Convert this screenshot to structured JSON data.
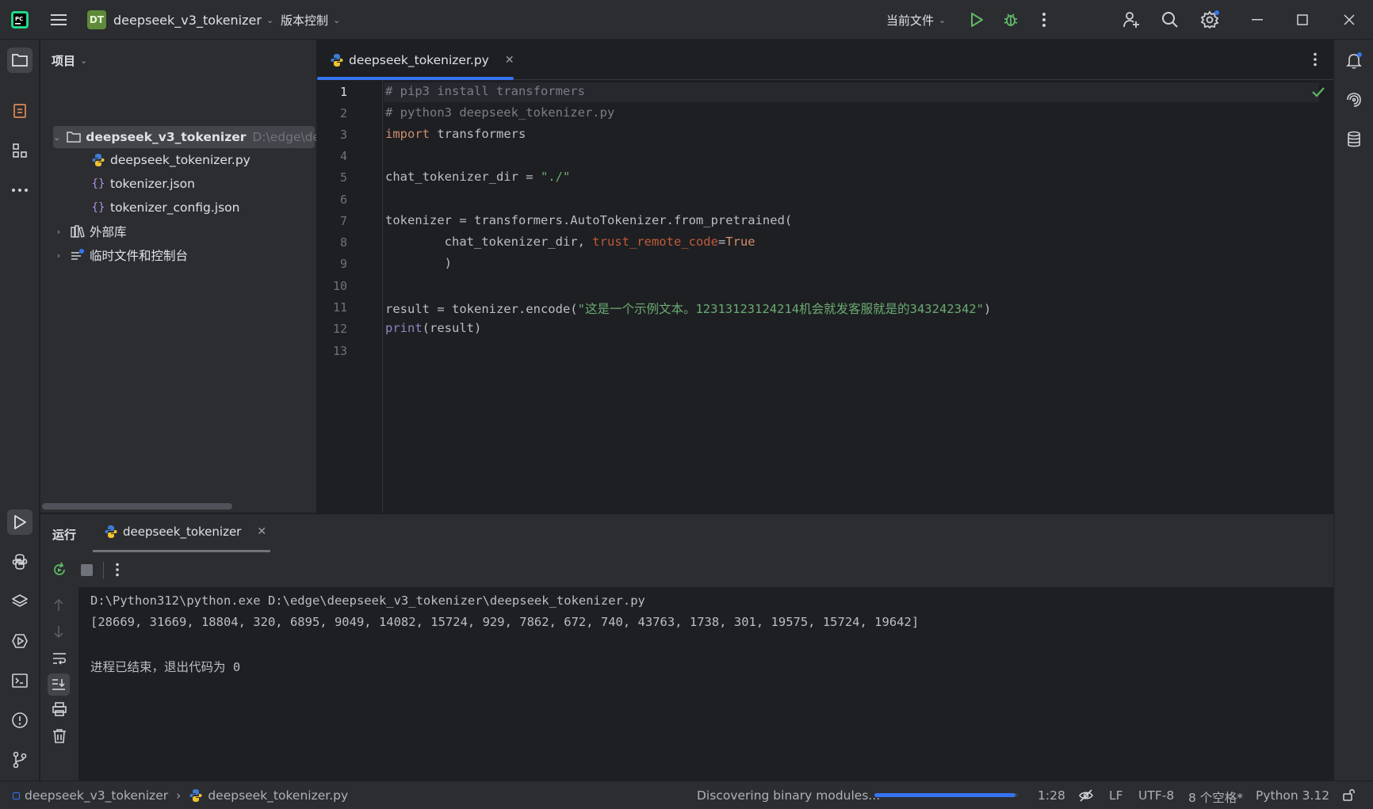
{
  "titlebar": {
    "project_badge": "DT",
    "project_name": "deepseek_v3_tokenizer",
    "vcs_menu": "版本控制",
    "run_config": "当前文件"
  },
  "project_panel": {
    "title": "项目",
    "root": {
      "name": "deepseek_v3_tokenizer",
      "path": "D:\\edge\\deep"
    },
    "files": [
      {
        "name": "deepseek_tokenizer.py",
        "icon": "python-file-icon"
      },
      {
        "name": "tokenizer.json",
        "icon": "json-file-icon"
      },
      {
        "name": "tokenizer_config.json",
        "icon": "json-file-icon"
      }
    ],
    "external_libs": "外部库",
    "scratches": "临时文件和控制台"
  },
  "editor": {
    "tab_label": "deepseek_tokenizer.py",
    "line_numbers": [
      "1",
      "2",
      "3",
      "4",
      "5",
      "6",
      "7",
      "8",
      "9",
      "10",
      "11",
      "12",
      "13"
    ],
    "lines": {
      "l1": "# pip3 install transformers",
      "l2": "# python3 deepseek_tokenizer.py",
      "l3_kw": "import",
      "l3_rest": " transformers",
      "l5_a": "chat_tokenizer_dir = ",
      "l5_str": "\"./\"",
      "l7": "tokenizer = transformers.AutoTokenizer.from_pretrained(",
      "l8_a": "        chat_tokenizer_dir, ",
      "l8_param": "trust_remote_code",
      "l8_eq": "=",
      "l8_kw": "True",
      "l9": "        )",
      "l11_a": "result = tokenizer.encode(",
      "l11_str": "\"这是一个示例文本。12313123124214机会就发客服就是的343242342\"",
      "l11_b": ")",
      "l12_fn": "print",
      "l12_rest": "(result)"
    }
  },
  "run_panel": {
    "title": "运行",
    "tab_label": "deepseek_tokenizer",
    "output": [
      "D:\\Python312\\python.exe D:\\edge\\deepseek_v3_tokenizer\\deepseek_tokenizer.py",
      "[28669, 31669, 18804, 320, 6895, 9049, 14082, 15724, 929, 7862, 672, 740, 43763, 1738, 301, 19575, 15724, 19642]",
      "",
      "进程已结束，退出代码为 0"
    ]
  },
  "statusbar": {
    "breadcrumb_project": "deepseek_v3_tokenizer",
    "breadcrumb_file": "deepseek_tokenizer.py",
    "task": "Discovering binary modules...",
    "progress": 0.98,
    "position": "1:28",
    "line_sep": "LF",
    "encoding": "UTF-8",
    "indent": "8 个空格*",
    "interpreter": "Python 3.12"
  },
  "colors": {
    "accent": "#3574f0",
    "background": "#1e1f22",
    "panel": "#2b2d30",
    "comment": "#7a7e85",
    "keyword": "#cf8e6d",
    "string": "#6aab73"
  }
}
